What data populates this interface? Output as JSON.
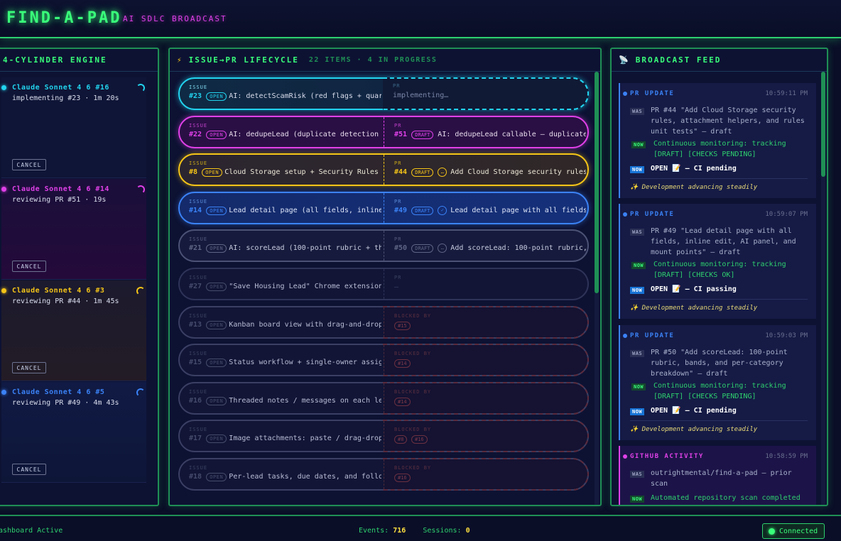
{
  "header": {
    "title": "FIND-A-PAD",
    "subtitle": "AI SDLC BROADCAST"
  },
  "engine": {
    "title": "4-CYLINDER ENGINE",
    "cylinders": [
      {
        "name": "Claude Sonnet 4 6 #16",
        "status": "implementing #23 · 1m 20s",
        "color": "#22d3ee",
        "cancel": "CANCEL"
      },
      {
        "name": "Claude Sonnet 4 6 #14",
        "status": "reviewing PR #51 · 19s",
        "color": "#e040e8",
        "cancel": "CANCEL"
      },
      {
        "name": "Claude Sonnet 4 6 #3",
        "status": "reviewing PR #44 · 1m 45s",
        "color": "#f5c518",
        "cancel": "CANCEL"
      },
      {
        "name": "Claude Sonnet 4 6 #5",
        "status": "reviewing PR #49 · 4m 43s",
        "color": "#3b82f6",
        "cancel": "CANCEL"
      }
    ]
  },
  "lifecycle": {
    "title": "ISSUE→PR LIFECYCLE",
    "summary": "22 ITEMS · 4 IN PROGRESS",
    "rows": [
      {
        "issue_label": "ISSUE",
        "issue": "#23",
        "state": "OPEN",
        "title": "AI: detectScamRisk (red flags + quar…",
        "pr_label": "PR",
        "pr_text": "implementing…"
      },
      {
        "issue_label": "ISSUE",
        "issue": "#22",
        "state": "OPEN",
        "title": "AI: dedupeLead (duplicate detection …",
        "pr_label": "PR",
        "pr": "#51",
        "pr_state": "DRAFT",
        "pr_title": "AI: dedupeLead callable — duplicate …"
      },
      {
        "issue_label": "ISSUE",
        "issue": "#8",
        "state": "OPEN",
        "title": "Cloud Storage setup + Security Rules …",
        "pr_label": "PR",
        "pr": "#44",
        "pr_state": "DRAFT",
        "pr_mini": "…",
        "pr_title": "Add Cloud Storage security rules…"
      },
      {
        "issue_label": "ISSUE",
        "issue": "#14",
        "state": "OPEN",
        "title": "Lead detail page (all fields, inline…",
        "pr_label": "PR",
        "pr": "#49",
        "pr_state": "DRAFT",
        "pr_mini": "✓",
        "pr_title": "Lead detail page with all fields…"
      },
      {
        "issue_label": "ISSUE",
        "issue": "#21",
        "state": "OPEN",
        "title": "AI: scoreLead (100-point rubric + th…",
        "pr_label": "PR",
        "pr": "#50",
        "pr_state": "DRAFT",
        "pr_mini": "…",
        "pr_title": "Add scoreLead: 100-point rubric,…"
      },
      {
        "issue_label": "ISSUE",
        "issue": "#27",
        "state": "OPEN",
        "title": "\"Save Housing Lead\" Chrome extension…",
        "pr_label": "PR",
        "pr_text": "—"
      },
      {
        "issue_label": "ISSUE",
        "issue": "#13",
        "state": "OPEN",
        "title": "Kanban board view with drag-and-drop…",
        "pr_label": "BLOCKED BY",
        "blocked": [
          "#15"
        ]
      },
      {
        "issue_label": "ISSUE",
        "issue": "#15",
        "state": "OPEN",
        "title": "Status workflow + single-owner assig…",
        "pr_label": "BLOCKED BY",
        "blocked": [
          "#14"
        ]
      },
      {
        "issue_label": "ISSUE",
        "issue": "#16",
        "state": "OPEN",
        "title": "Threaded notes / messages on each le…",
        "pr_label": "BLOCKED BY",
        "blocked": [
          "#14"
        ]
      },
      {
        "issue_label": "ISSUE",
        "issue": "#17",
        "state": "OPEN",
        "title": "Image attachments: paste / drag-drop…",
        "pr_label": "BLOCKED BY",
        "blocked": [
          "#8",
          "#16"
        ]
      },
      {
        "issue_label": "ISSUE",
        "issue": "#18",
        "state": "OPEN",
        "title": "Per-lead tasks, due dates, and follo…",
        "pr_label": "BLOCKED BY",
        "blocked": [
          "#16"
        ]
      }
    ]
  },
  "feed": {
    "title": "BROADCAST FEED",
    "cards": [
      {
        "type": "PR UPDATE",
        "time": "10:59:11 PM",
        "was_tag": "WAS",
        "was": "PR #44 \"Add Cloud Storage security rules, attachment helpers, and rules unit tests\" — draft",
        "now_tag": "NOW",
        "now": "Continuous monitoring: tracking [DRAFT] [CHECKS PENDING]",
        "now2_tag": "NOW",
        "now2": "OPEN 📝 — CI pending",
        "foot": "✨ Development advancing steadily"
      },
      {
        "type": "PR UPDATE",
        "time": "10:59:07 PM",
        "was_tag": "WAS",
        "was": "PR #49 \"Lead detail page with all fields, inline edit, AI panel, and mount points\" — draft",
        "now_tag": "NOW",
        "now": "Continuous monitoring: tracking [DRAFT] [CHECKS OK]",
        "now2_tag": "NOW",
        "now2": "OPEN 📝 — CI passing",
        "foot": "✨ Development advancing steadily"
      },
      {
        "type": "PR UPDATE",
        "time": "10:59:03 PM",
        "was_tag": "WAS",
        "was": "PR #50 \"Add scoreLead: 100-point rubric, bands, and per-category breakdown\" — draft",
        "now_tag": "NOW",
        "now": "Continuous monitoring: tracking [DRAFT] [CHECKS PENDING]",
        "now2_tag": "NOW",
        "now2": "OPEN 📝 — CI pending",
        "foot": "✨ Development advancing steadily"
      },
      {
        "type": "GITHUB ACTIVITY",
        "time": "10:58:59 PM",
        "was_tag": "WAS",
        "was": "outrightmental/find-a-pad — prior scan",
        "now_tag": "NOW",
        "now": "Automated repository scan completed"
      }
    ]
  },
  "footer": {
    "status": "ashboard Active",
    "events_label": "Events:",
    "events": "716",
    "sessions_label": "Sessions:",
    "sessions": "0",
    "connection": "Connected"
  },
  "colors": {
    "accent": "#39ff7a",
    "magenta": "#e040e8",
    "cyan": "#22d3ee",
    "yellow": "#f5c518",
    "blue": "#3b82f6"
  }
}
